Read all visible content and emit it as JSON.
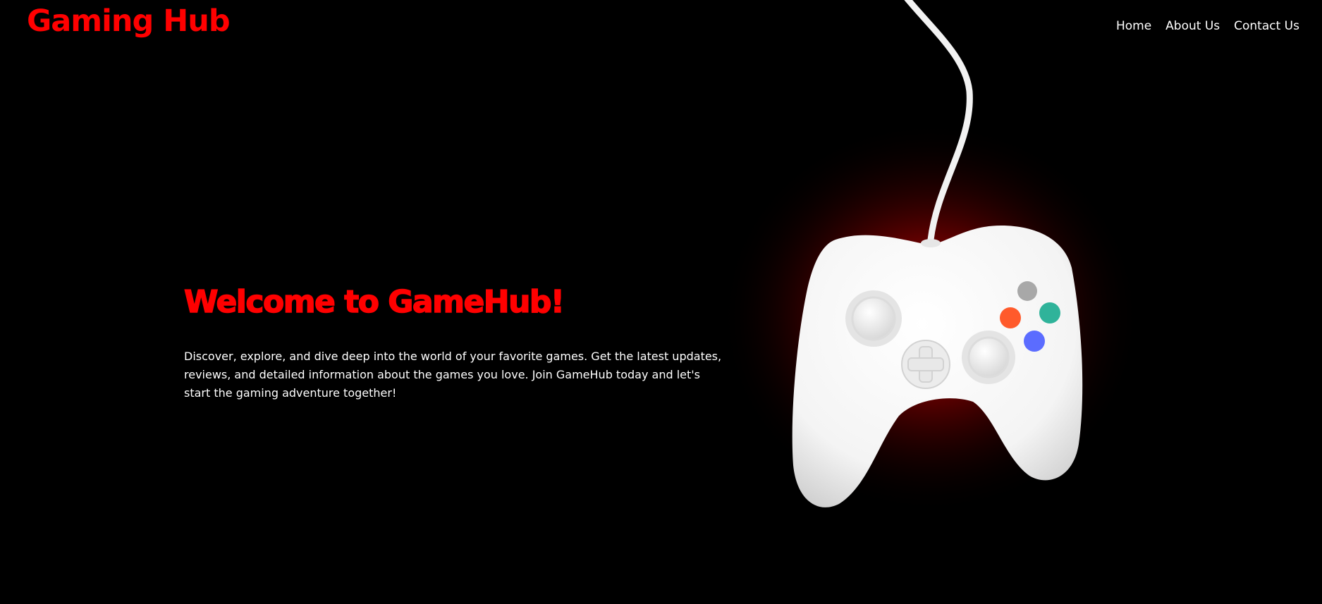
{
  "header": {
    "logo_text": "Gaming Hub",
    "nav": [
      "Home",
      "About Us",
      "Contact Us"
    ]
  },
  "hero": {
    "title": "Welcome to GameHub!",
    "description": "Discover, explore, and dive deep into the world of your favorite games. Get the latest updates, reviews, and detailed information about the games you love. Join GameHub today and let's start the gaming adventure together!"
  },
  "theme": {
    "accent": "#ff0000",
    "background": "#000000",
    "text": "#ffffff"
  },
  "illustration": {
    "icon": "game-controller-icon",
    "glow_color": "#e00000",
    "body_color": "#f4f4f4",
    "button_colors": [
      "#a8a8a8",
      "#ff5a2b",
      "#2fb39a",
      "#5b6cff"
    ]
  }
}
